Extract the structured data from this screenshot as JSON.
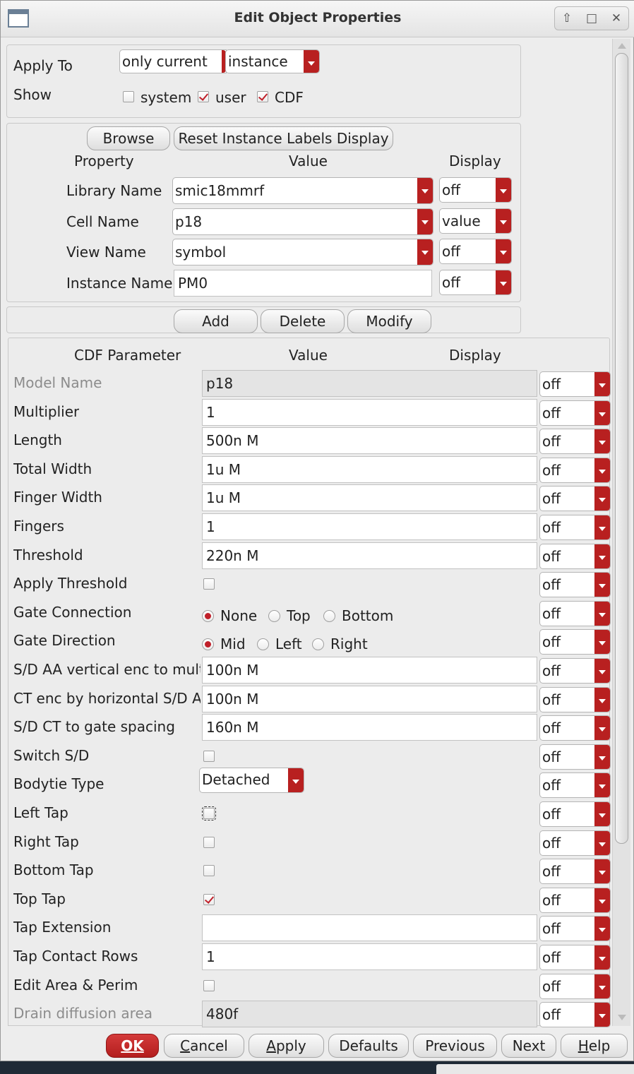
{
  "window": {
    "title": "Edit Object Properties",
    "wm_buttons": [
      "⇧",
      "□",
      "✕"
    ]
  },
  "apply_to": {
    "label": "Apply To",
    "scope_value": "only current",
    "target_value": "instance"
  },
  "show": {
    "label": "Show",
    "options": [
      {
        "label": "system",
        "checked": false
      },
      {
        "label": "user",
        "checked": true
      },
      {
        "label": "CDF",
        "checked": true
      }
    ]
  },
  "properties": {
    "browse_label": "Browse",
    "reset_label": "Reset Instance Labels Display",
    "headers": {
      "property": "Property",
      "value": "Value",
      "display": "Display"
    },
    "rows": [
      {
        "label": "Library Name",
        "value": "smic18mmrf",
        "display": "off"
      },
      {
        "label": "Cell Name",
        "value": "p18",
        "display": "value"
      },
      {
        "label": "View Name",
        "value": "symbol",
        "display": "off"
      },
      {
        "label": "Instance Name",
        "value": "PM0",
        "display": "off"
      }
    ]
  },
  "actions": {
    "add": "Add",
    "delete": "Delete",
    "modify": "Modify"
  },
  "cdf": {
    "headers": {
      "param": "CDF Parameter",
      "value": "Value",
      "display": "Display"
    },
    "rows": [
      {
        "label": "Model Name",
        "value": "p18",
        "display": "off"
      },
      {
        "label": "Multiplier",
        "value": "1",
        "display": "off"
      },
      {
        "label": "Length",
        "value": "500n M",
        "display": "off"
      },
      {
        "label": "Total Width",
        "value": "1u M",
        "display": "off"
      },
      {
        "label": "Finger Width",
        "value": "1u M",
        "display": "off"
      },
      {
        "label": "Fingers",
        "value": "1",
        "display": "off"
      },
      {
        "label": "Threshold",
        "value": "220n M",
        "display": "off"
      },
      {
        "label": "Apply Threshold",
        "display": "off"
      },
      {
        "label": "Gate Connection",
        "options": [
          "None",
          "Top",
          "Bottom"
        ],
        "selected": "None",
        "display": "off"
      },
      {
        "label": "Gate Direction",
        "options": [
          "Mid",
          "Left",
          "Right"
        ],
        "selected": "Mid",
        "display": "off"
      },
      {
        "label": "S/D AA vertical enc to multi",
        "value": "100n M",
        "display": "off"
      },
      {
        "label": "CT enc by horizontal S/D A/",
        "value": "100n M",
        "display": "off"
      },
      {
        "label": "S/D CT to gate spacing",
        "value": "160n M",
        "display": "off"
      },
      {
        "label": "Switch S/D",
        "display": "off"
      },
      {
        "label": "Bodytie Type",
        "value": "Detached",
        "display": "off"
      },
      {
        "label": "Left Tap",
        "display": "off"
      },
      {
        "label": "Right Tap",
        "display": "off"
      },
      {
        "label": "Bottom Tap",
        "display": "off"
      },
      {
        "label": "Top Tap",
        "display": "off"
      },
      {
        "label": "Tap Extension",
        "value": "",
        "display": "off"
      },
      {
        "label": "Tap Contact Rows",
        "value": "1",
        "display": "off"
      },
      {
        "label": "Edit Area & Perim",
        "display": "off"
      },
      {
        "label": "Drain diffusion area",
        "value": "480f",
        "display": "off"
      }
    ],
    "checkboxes": {
      "apply_threshold": false,
      "switch_sd": false,
      "left_tap": false,
      "right_tap": false,
      "bottom_tap": false,
      "top_tap": true,
      "edit_area_perim": false
    }
  },
  "footer": {
    "ok": "OK",
    "cancel_first": "C",
    "cancel_rest": "ancel",
    "apply_first": "A",
    "apply_rest": "pply",
    "defaults": "Defaults",
    "previous": "Previous",
    "next": "Next",
    "help_first": "H",
    "help_rest": "elp"
  },
  "colors": {
    "accent": "#b82020",
    "window_bg": "#ededed"
  }
}
